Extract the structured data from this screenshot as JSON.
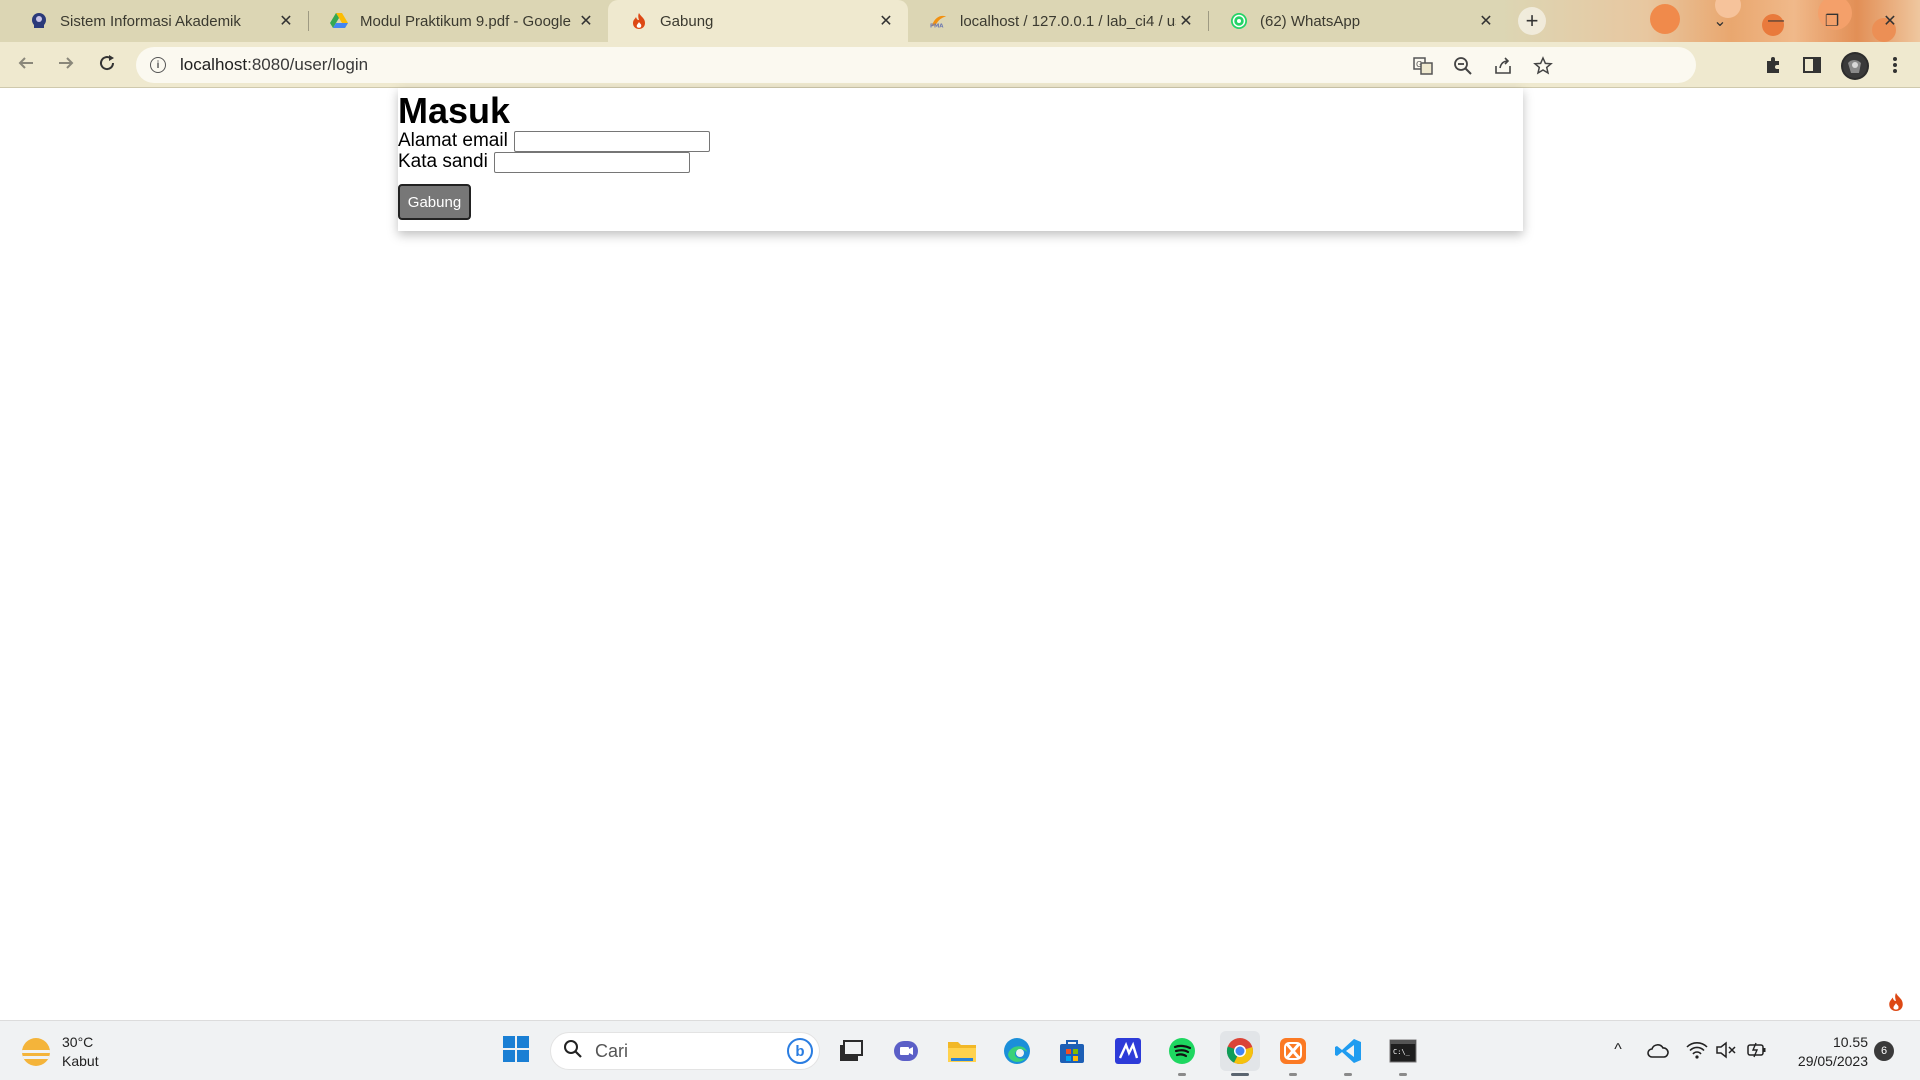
{
  "browser": {
    "tabs": [
      {
        "title": "Sistem Informasi Akademik",
        "favicon": "university-icon",
        "active": false
      },
      {
        "title": "Modul Praktikum 9.pdf - Google",
        "favicon": "google-drive-icon",
        "active": false
      },
      {
        "title": "Gabung",
        "favicon": "codeigniter-flame-icon",
        "active": true
      },
      {
        "title": "localhost / 127.0.0.1 / lab_ci4 / us",
        "favicon": "phpmyadmin-icon",
        "active": false
      },
      {
        "title": "(62) WhatsApp",
        "favicon": "whatsapp-icon",
        "active": false
      }
    ],
    "close_glyph": "✕",
    "new_tab_glyph": "+",
    "address": {
      "host": "localhost",
      "path": ":8080/user/login"
    },
    "window_controls": {
      "minimize": "—",
      "maximize": "❐",
      "close": "✕",
      "tab_search": "⌄"
    }
  },
  "page": {
    "heading": "Masuk",
    "email_label": "Alamat email",
    "email_value": "",
    "password_label": "Kata sandi",
    "password_value": "",
    "submit_label": "Gabung"
  },
  "taskbar": {
    "weather": {
      "temp": "30°C",
      "condition": "Kabut"
    },
    "search_placeholder": "Cari",
    "bing_glyph": "b",
    "clock": {
      "time": "10.55",
      "date": "29/05/2023"
    },
    "notification_count": "6",
    "tray_chevron": "^"
  },
  "colors": {
    "tab_strip": "#dcd6b4",
    "toolbar": "#efe9cf",
    "button_gray": "#777777",
    "taskbar": "#f0f2f3"
  }
}
